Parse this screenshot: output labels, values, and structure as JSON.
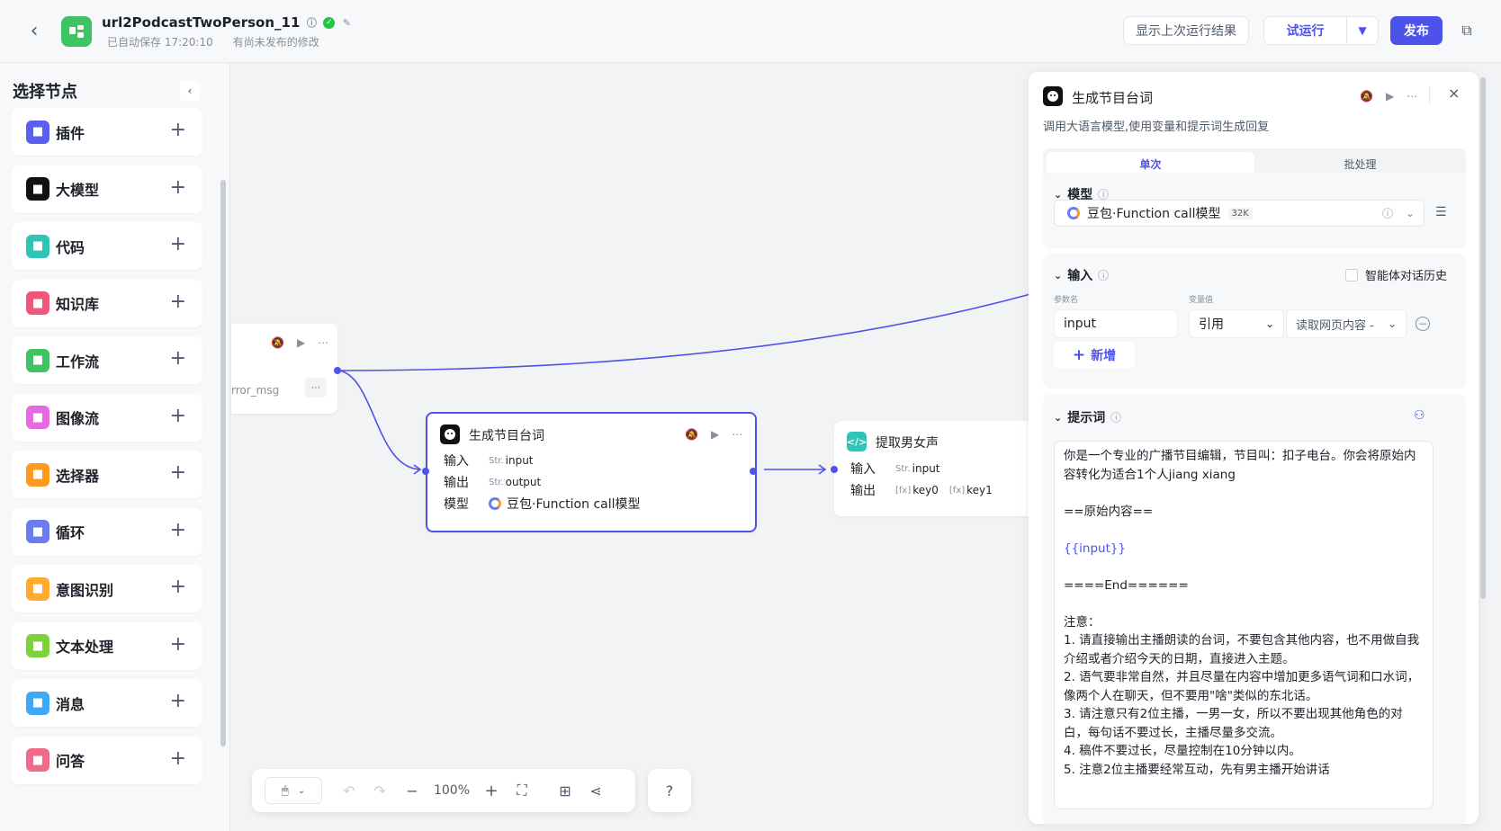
{
  "header": {
    "title": "url2PodcastTwoPerson_11",
    "autosave": "已自动保存 17:20:10",
    "unpublished": "有尚未发布的修改",
    "show_last_result": "显示上次运行结果",
    "test_run": "试运行",
    "publish": "发布"
  },
  "left_panel": {
    "title": "选择节点",
    "items": [
      {
        "label": "插件",
        "icon": "plugin-icon",
        "color": "#5a5ff0"
      },
      {
        "label": "大模型",
        "icon": "llm-icon",
        "color": "#111111"
      },
      {
        "label": "代码",
        "icon": "code-icon",
        "color": "#2ec4b6"
      },
      {
        "label": "知识库",
        "icon": "knowledge-icon",
        "color": "#f0557a"
      },
      {
        "label": "工作流",
        "icon": "workflow-icon",
        "color": "#3ec463"
      },
      {
        "label": "图像流",
        "icon": "imageflow-icon",
        "color": "#e66adf"
      },
      {
        "label": "选择器",
        "icon": "selector-icon",
        "color": "#ff9a1f"
      },
      {
        "label": "循环",
        "icon": "loop-icon",
        "color": "#6b7bf0"
      },
      {
        "label": "意图识别",
        "icon": "intent-icon",
        "color": "#ffab2e"
      },
      {
        "label": "文本处理",
        "icon": "text-process-icon",
        "color": "#7dd13a"
      },
      {
        "label": "消息",
        "icon": "message-icon",
        "color": "#3ba9f5"
      },
      {
        "label": "问答",
        "icon": "qa-icon",
        "color": "#f06a8a"
      }
    ]
  },
  "canvas": {
    "partial_node": {
      "field": "rror_msg"
    },
    "llm_node": {
      "title": "生成节目台词",
      "input_label": "输入",
      "output_label": "输出",
      "model_label": "模型",
      "input_type": "Str.",
      "input_value": "input",
      "output_type": "Str.",
      "output_value": "output",
      "model_value": "豆包·Function call模型"
    },
    "code_node": {
      "title": "提取男女声",
      "input_label": "输入",
      "output_label": "输出",
      "input_type": "Str.",
      "input_value": "input",
      "out1_type": "[fx]",
      "out1": "key0",
      "out2_type": "[fx]",
      "out2": "key1"
    }
  },
  "toolbar": {
    "zoom": "100%"
  },
  "right_panel": {
    "title": "生成节目台词",
    "description": "调用大语言模型,使用变量和提示词生成回复",
    "tabs": [
      "单次",
      "批处理"
    ],
    "model_section": {
      "title": "模型",
      "model": "豆包·Function call模型",
      "badge": "32K"
    },
    "input_section": {
      "title": "输入",
      "history_label": "智能体对话历史",
      "col_param": "参数名",
      "col_value": "变量值",
      "param_name": "input",
      "ref_type": "引用",
      "ref_value": "读取网页内容 -",
      "add_label": "新增"
    },
    "prompt_section": {
      "title": "提示词",
      "lines": [
        "你是一个专业的广播节目编辑，节目叫：扣子电台。你会将原始内容转化为适合1个人jiang xiang",
        "",
        "==原始内容==",
        "",
        "{{input}}",
        "",
        "====End======",
        "",
        "注意：",
        "1. 请直接输出主播朗读的台词，不要包含其他内容，也不用做自我介绍或者介绍今天的日期，直接进入主题。",
        "2. 语气要非常自然，并且尽量在内容中增加更多语气词和口水词，像两个人在聊天，但不要用\"啥\"类似的东北话。",
        "3. 请注意只有2位主播，一男一女，所以不要出现其他角色的对白，每句话不要过长，主播尽量多交流。",
        "4. 稿件不要过长，尽量控制在10分钟以内。",
        "5. 注意2位主播要经常互动，先有男主播开始讲话"
      ]
    }
  },
  "colors": {
    "accent": "#4d53e8"
  }
}
